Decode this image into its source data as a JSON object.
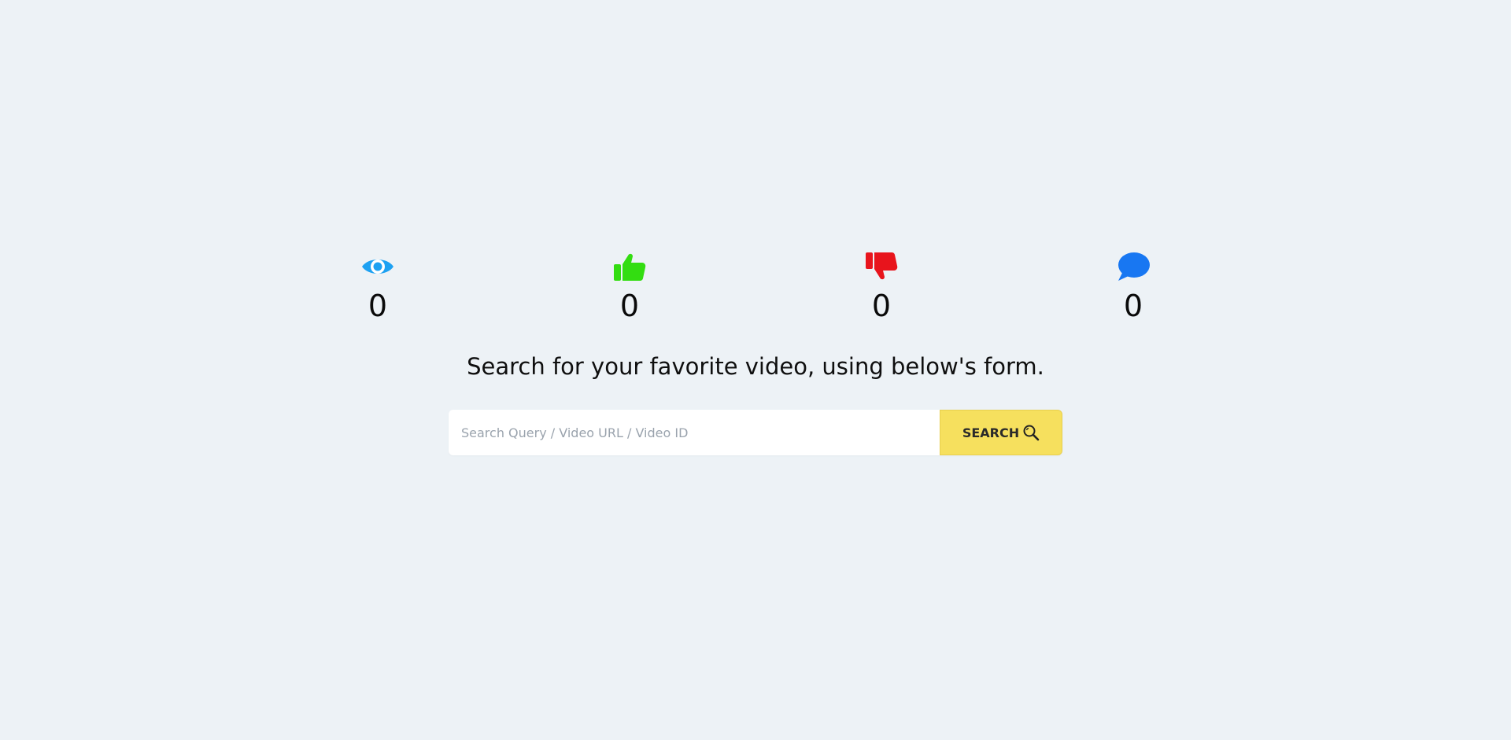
{
  "stats": {
    "views": {
      "icon": "eye-icon",
      "value": "0",
      "color": "#1da1f2"
    },
    "likes": {
      "icon": "thumbs-up-icon",
      "value": "0",
      "color": "#33dd11"
    },
    "dislikes": {
      "icon": "thumbs-down-icon",
      "value": "0",
      "color": "#e8141c"
    },
    "comments": {
      "icon": "comment-icon",
      "value": "0",
      "color": "#1877f2"
    }
  },
  "headline": "Search for your favorite video, using below's form.",
  "search": {
    "placeholder": "Search Query / Video URL / Video ID",
    "value": "",
    "button_label": "SEARCH",
    "button_icon": "magnifier-icon",
    "button_color": "#f6e05e"
  },
  "colors": {
    "background": "#edf2f6"
  }
}
